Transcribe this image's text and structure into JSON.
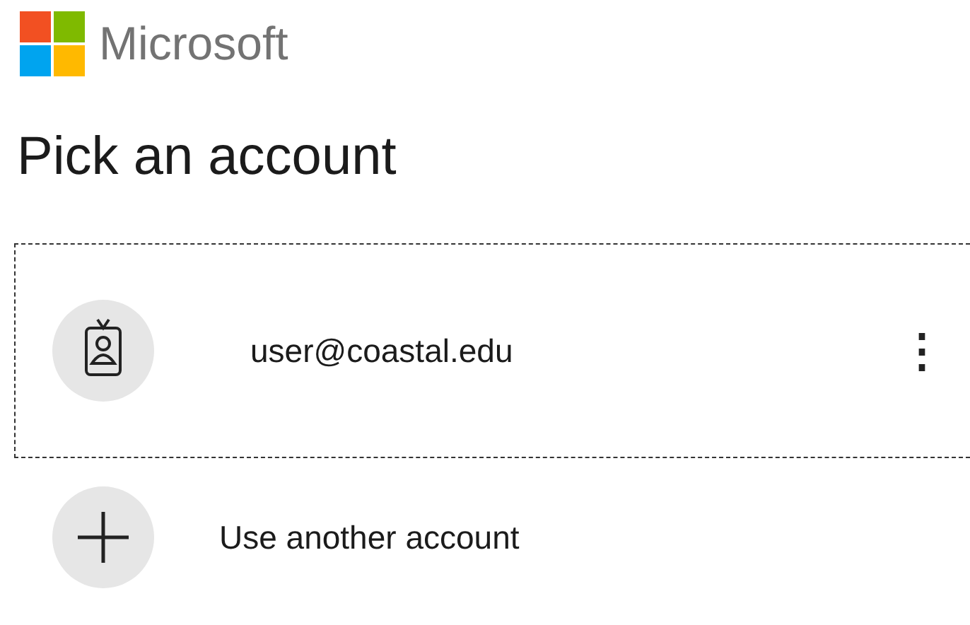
{
  "brand": {
    "name": "Microsoft"
  },
  "title": "Pick an account",
  "items": [
    {
      "kind": "account",
      "label": "user@coastal.edu",
      "menu": "⋮",
      "selected": true
    },
    {
      "kind": "add",
      "label": "Use another account",
      "selected": false
    }
  ]
}
